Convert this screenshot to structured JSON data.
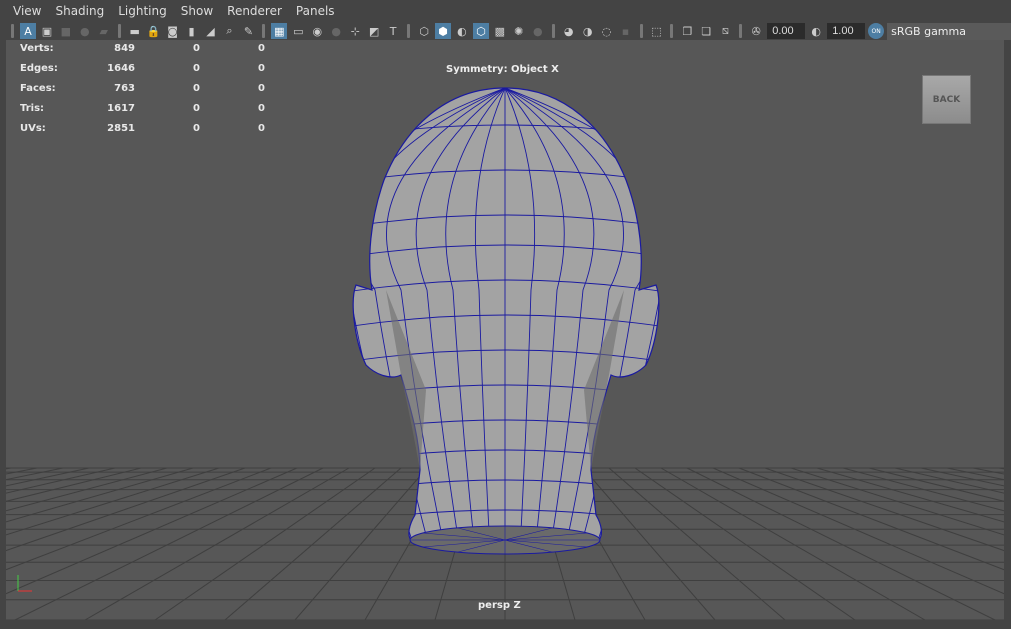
{
  "menu": [
    "View",
    "Shading",
    "Lighting",
    "Show",
    "Renderer",
    "Panels"
  ],
  "toolbar": {
    "exposure": "0.00",
    "gamma": "1.00",
    "color_space": "sRGB gamma (legacy)",
    "colorspace_toggle": "ON"
  },
  "stats": [
    {
      "label": "Verts:",
      "v1": "849",
      "v2": "0",
      "v3": "0"
    },
    {
      "label": "Edges:",
      "v1": "1646",
      "v2": "0",
      "v3": "0"
    },
    {
      "label": "Faces:",
      "v1": "763",
      "v2": "0",
      "v3": "0"
    },
    {
      "label": "Tris:",
      "v1": "1617",
      "v2": "0",
      "v3": "0"
    },
    {
      "label": "UVs:",
      "v1": "2851",
      "v2": "0",
      "v3": "0"
    }
  ],
  "symmetry": "Symmetry: Object X",
  "camera": "persp Z",
  "back_button": "BACK",
  "colors": {
    "accent": "#4d7ea3",
    "wireframe": "#1a1aa0",
    "mesh": "#a0a0a0"
  }
}
